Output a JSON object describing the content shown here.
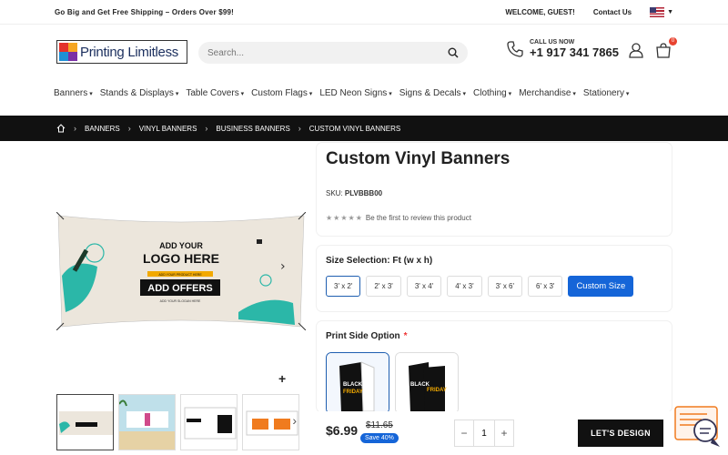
{
  "topbar": {
    "promo": "Go Big and Get Free Shipping – Orders Over $99!",
    "welcome": "WELCOME, GUEST!",
    "contact": "Contact Us",
    "flag_icon": "us-flag-icon"
  },
  "header": {
    "logo_text": "Printing Limitless",
    "search_placeholder": "Search...",
    "call_label": "CALL US NOW",
    "phone": "+1 917 341 7865",
    "cart_count": "0"
  },
  "nav": [
    "Banners",
    "Stands & Displays",
    "Table Covers",
    "Custom Flags",
    "LED Neon Signs",
    "Signs & Decals",
    "Clothing",
    "Merchandise",
    "Stationery"
  ],
  "breadcrumb": [
    "BANNERS",
    "VINYL BANNERS",
    "BUSINESS BANNERS",
    "CUSTOM VINYL BANNERS"
  ],
  "product": {
    "title": "Custom Vinyl Banners",
    "sku_label": "SKU:",
    "sku": "PLVBBB00",
    "review_text": "Be the first to review this product",
    "stars": "★★★★★",
    "banner_text1": "ADD YOUR",
    "banner_text2": "LOGO HERE",
    "banner_text3": "ADD YOUR PRODUCT HERE",
    "banner_text4": "ADD OFFERS",
    "banner_text5": "ADD YOUR SLOGAN HERE"
  },
  "size": {
    "label": "Size Selection: Ft (w x h)",
    "options": [
      "3' x 2'",
      "2' x 3'",
      "3' x 4'",
      "4' x 3'",
      "3' x 6'",
      "6' x 3'"
    ],
    "selected": "3' x 2'",
    "custom": "Custom Size"
  },
  "print_side": {
    "label": "Print Side Option",
    "required": "*"
  },
  "purchase": {
    "price": "$6.99",
    "old_price": "$11.65",
    "save": "Save 40%",
    "qty": "1",
    "minus": "−",
    "plus": "+",
    "design_button": "LET'S DESIGN"
  },
  "gallery": {
    "plus": "+",
    "next": "›",
    "prev": "‹"
  },
  "colors": {
    "accent": "#1565d8",
    "dark": "#111111",
    "teal": "#2bb7a8"
  }
}
